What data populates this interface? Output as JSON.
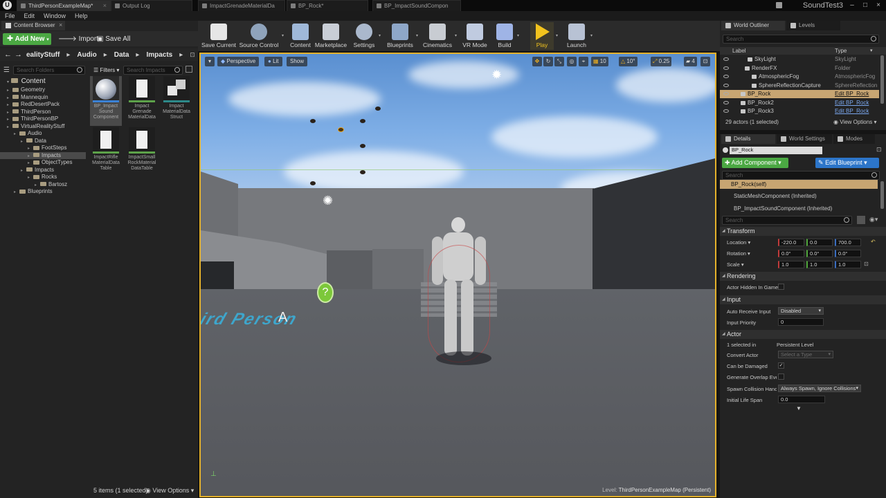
{
  "titlebar": {
    "tabs": [
      {
        "label": "ThirdPersonExampleMap*"
      },
      {
        "label": "Output Log"
      },
      {
        "label": "ImpactGrenadeMaterialDa"
      },
      {
        "label": "BP_Rock*"
      },
      {
        "label": "BP_ImpactSoundCompon"
      }
    ],
    "project": "SoundTest3"
  },
  "menubar": {
    "items": [
      "File",
      "Edit",
      "Window",
      "Help"
    ]
  },
  "content_browser": {
    "tab": "Content Browser",
    "toolbar": {
      "add_new": "Add New",
      "import": "Import",
      "save_all": "Save All"
    },
    "path": [
      "ealityStuff",
      "Audio",
      "Data",
      "Impacts"
    ],
    "search_folders_placeholder": "Search Folders",
    "filters": "Filters",
    "search_impacts_placeholder": "Search Impacts",
    "tree_root": "Content",
    "tree": [
      {
        "label": "Geometry",
        "indent": 0
      },
      {
        "label": "Mannequin",
        "indent": 0
      },
      {
        "label": "RedDesertPack",
        "indent": 0
      },
      {
        "label": "ThirdPerson",
        "indent": 0
      },
      {
        "label": "ThirdPersonBP",
        "indent": 0
      },
      {
        "label": "VirtualRealityStuff",
        "indent": 0
      },
      {
        "label": "Audio",
        "indent": 1
      },
      {
        "label": "Data",
        "indent": 2
      },
      {
        "label": "FootSteps",
        "indent": 3
      },
      {
        "label": "Impacts",
        "indent": 3
      },
      {
        "label": "ObjectTypes",
        "indent": 3
      },
      {
        "label": "Impacts",
        "indent": 2
      },
      {
        "label": "Rocks",
        "indent": 3
      },
      {
        "label": "Bartosz",
        "indent": 4
      },
      {
        "label": "Blueprints",
        "indent": 1
      }
    ],
    "assets": [
      {
        "label": "BP_Impact Sound Component"
      },
      {
        "label": "Impact Grenade MaterialData"
      },
      {
        "label": "Impact MaterialData Struct"
      },
      {
        "label": "ImpactRifle MaterialData Table"
      },
      {
        "label": "ImpactSmall RockMaterial DataTable"
      }
    ],
    "status": "5 items (1 selected)",
    "view_options": "View Options"
  },
  "main_toolbar": {
    "tools": [
      "Save Current",
      "Source Control",
      "Content",
      "Marketplace",
      "Settings",
      "Blueprints",
      "Cinematics",
      "VR Mode",
      "Build",
      "Play",
      "Launch"
    ]
  },
  "viewport": {
    "perspective": "Perspective",
    "lit": "Lit",
    "show": "Show",
    "grid_snap": "10",
    "rot_snap": "10°",
    "scale_snap": "0.25",
    "cam_speed": "4",
    "floor_text": "ird Person",
    "level_label": "Level:",
    "level_name": "ThirdPersonExampleMap (Persistent)"
  },
  "outliner": {
    "tab": "World Outliner",
    "tab2": "Levels",
    "search_placeholder": "Search",
    "col_label": "Label",
    "col_type": "Type",
    "rows": [
      {
        "label": "SkyLight",
        "type": "SkyLight",
        "link": false,
        "selected": false
      },
      {
        "label": "RenderFX",
        "type": "Folder",
        "link": false,
        "selected": false
      },
      {
        "label": "AtmosphericFog",
        "type": "AtmosphericFog",
        "link": false,
        "selected": false
      },
      {
        "label": "SphereReflectionCapture",
        "type": "SphereReflection",
        "link": false,
        "selected": false
      },
      {
        "label": "BP_Rock",
        "type": "Edit BP_Rock",
        "link": true,
        "selected": true
      },
      {
        "label": "BP_Rock2",
        "type": "Edit BP_Rock",
        "link": true,
        "selected": false
      },
      {
        "label": "BP_Rock3",
        "type": "Edit BP_Rock",
        "link": true,
        "selected": false
      }
    ],
    "footer": "29 actors (1 selected)",
    "view_options": "View Options"
  },
  "details": {
    "tabs": [
      "Details",
      "World Settings",
      "Modes"
    ],
    "name": "BP_Rock",
    "add_component": "Add Component",
    "edit_blueprint": "Edit Blueprint",
    "search_placeholder": "Search",
    "self": "BP_Rock(self)",
    "components": [
      "StaticMeshComponent (Inherited)",
      "BP_ImpactSoundComponent (Inherited)"
    ],
    "search2_placeholder": "Search",
    "transform": {
      "title": "Transform",
      "location_label": "Location",
      "location": [
        "-220.0",
        "0.0",
        "700.0"
      ],
      "rotation_label": "Rotation",
      "rotation": [
        "0.0°",
        "0.0°",
        "0.0°"
      ],
      "scale_label": "Scale",
      "scale": [
        "1.0",
        "1.0",
        "1.0"
      ]
    },
    "rendering": {
      "title": "Rendering",
      "actor_hidden": "Actor Hidden In Game"
    },
    "input": {
      "title": "Input",
      "auto_receive_label": "Auto Receive Input",
      "auto_receive_value": "Disabled",
      "priority_label": "Input Priority",
      "priority_value": "0"
    },
    "actor": {
      "title": "Actor",
      "selected_label": "1 selected in",
      "selected_value": "Persistent Level",
      "convert_label": "Convert Actor",
      "convert_value": "Select a Type",
      "damaged_label": "Can be Damaged",
      "overlap_label": "Generate Overlap Events",
      "spawn_label": "Spawn Collision Handling",
      "spawn_value": "Always Spawn, Ignore Collisions",
      "lifespan_label": "Initial Life Span",
      "lifespan_value": "0.0"
    }
  },
  "colors": {
    "accent_green": "#4ba843",
    "accent_blue": "#2c75c9",
    "selection": "#c7a572",
    "viewport_border": "#e4b12a"
  }
}
